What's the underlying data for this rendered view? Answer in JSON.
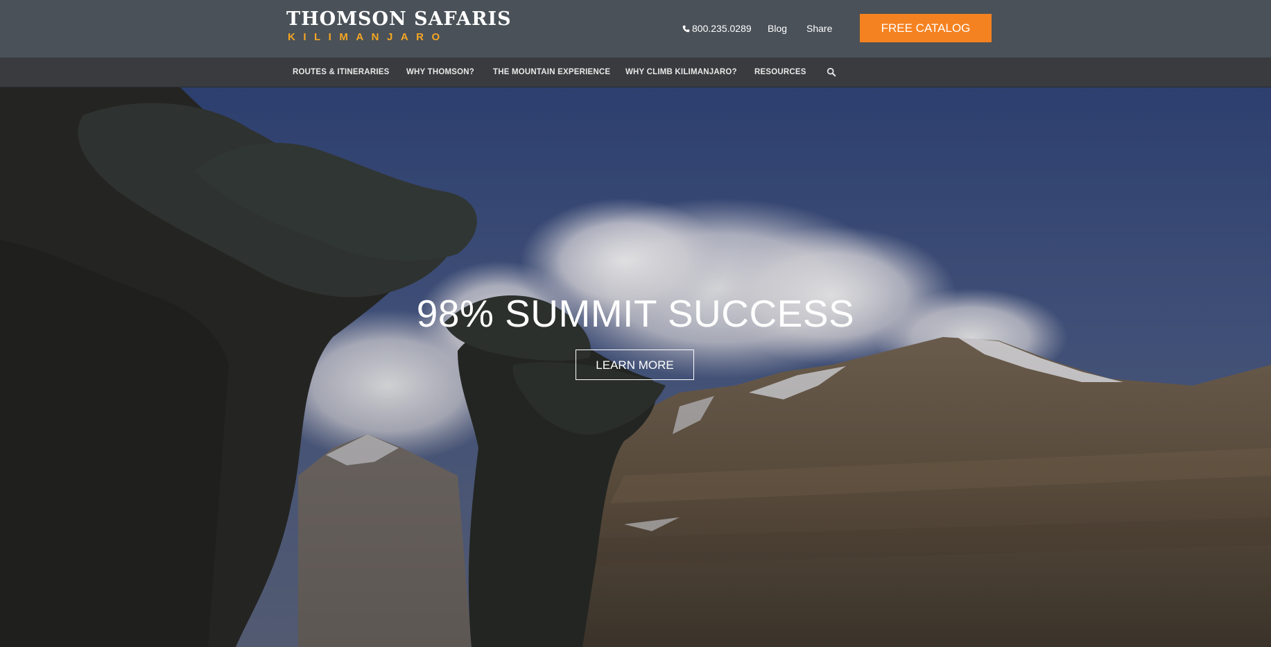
{
  "header": {
    "logo_main": "THOMSON SAFARIS",
    "logo_sub": "KILIMANJARO",
    "phone": "800.235.0289",
    "blog": "Blog",
    "share": "Share",
    "catalog_button": "FREE CATALOG",
    "accent_color": "#f58220",
    "logo_sub_color": "#f5a623"
  },
  "nav": {
    "items": [
      {
        "label": "ROUTES & ITINERARIES"
      },
      {
        "label": "WHY THOMSON?"
      },
      {
        "label": "THE MOUNTAIN EXPERIENCE"
      },
      {
        "label": "WHY CLIMB KILIMANJARO?"
      },
      {
        "label": "RESOURCES"
      }
    ],
    "search_icon": "search-icon"
  },
  "hero": {
    "headline": "98% SUMMIT SUCCESS",
    "button": "LEARN MORE"
  }
}
